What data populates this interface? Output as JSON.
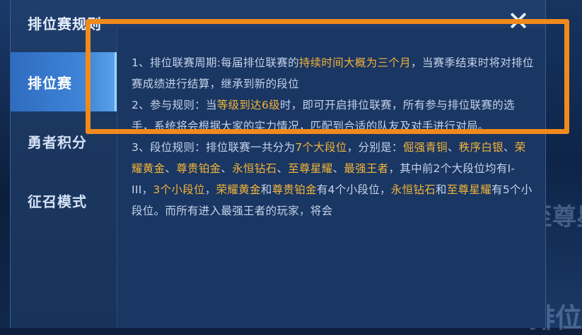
{
  "panel": {
    "title": "排位赛规则",
    "close_icon": "close-icon"
  },
  "tabs": [
    {
      "label": "排位赛",
      "active": true
    },
    {
      "label": "勇者积分",
      "active": false
    },
    {
      "label": "征召模式",
      "active": false
    }
  ],
  "background": {
    "right_text_1": "至尊星",
    "right_text_2": "排位"
  },
  "rules": {
    "p1": {
      "a": "1、排位联赛周期:每届排位联赛的",
      "hl": "持续时间大概为三个月",
      "b": "，当赛季结束时将对排位赛成绩进行结算，继承到新的段位"
    },
    "p2": {
      "a": "2、参与规则：当",
      "hl": "等级到达6级",
      "b": "时，即可开启排位联赛，所有参与排位联赛的选手，系统将会根据大家的实力情况，匹配到合适的队友及对手进行对局。"
    },
    "p3": {
      "a": "3、段位规则：排位联赛一共分为",
      "hl1": "7个大段位",
      "b": "，分别是：",
      "hl2": "倔强青铜",
      "s1": "、",
      "hl3": "秩序白银",
      "s2": "、",
      "hl4": "荣耀黄金",
      "s3": "、",
      "hl5": "尊贵铂金",
      "s4": "、",
      "hl6": "永恒钻石",
      "s5": "、",
      "hl7": "至尊星耀",
      "s6": "、",
      "hl8": "最强王者",
      "c": "，其中前2个大段位均有I-III，",
      "hl9": "3个小段位",
      "d": "，",
      "hl10": "荣耀黄金",
      "e": "和",
      "hl11": "尊贵铂金",
      "f": "有4个小段位，",
      "hl12": "永恒钻石",
      "g": "和",
      "hl13": "至尊星耀",
      "h": "有5个小段位。而所有进入最强王者的玩家，将会"
    }
  },
  "colors": {
    "highlight": "#f2b43a",
    "frame": "#f08a1c",
    "text": "#c5d3ea"
  }
}
